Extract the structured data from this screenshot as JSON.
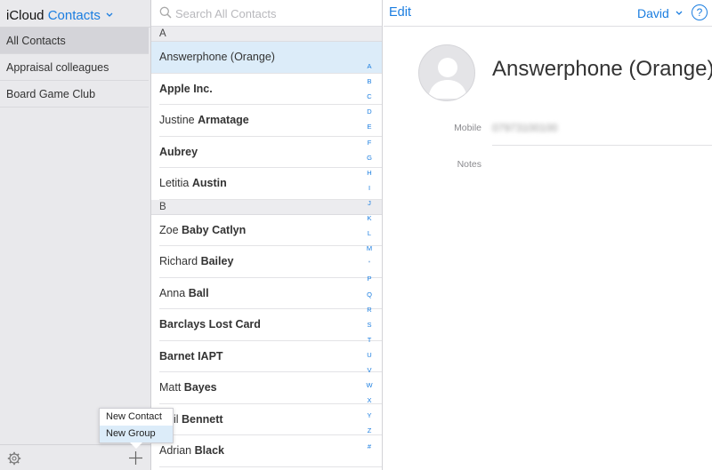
{
  "sidebar": {
    "brand": "iCloud",
    "app_name": "Contacts",
    "groups": [
      {
        "label": "All Contacts",
        "active": true
      },
      {
        "label": "Appraisal colleagues",
        "active": false
      },
      {
        "label": "Board Game Club",
        "active": false
      }
    ],
    "icons": {
      "settings": "gear-icon",
      "add": "plus-icon"
    }
  },
  "popover": {
    "items": [
      {
        "label": "New Contact",
        "active": false
      },
      {
        "label": "New Group",
        "active": true
      }
    ]
  },
  "search": {
    "placeholder": "Search All Contacts"
  },
  "contact_list": {
    "sections": [
      {
        "letter": "A",
        "contacts": [
          {
            "first": "",
            "last": "Answerphone (Orange)",
            "selected": true
          },
          {
            "first": "",
            "last": "Apple Inc.",
            "selected": false
          },
          {
            "first": "Justine",
            "last": "Armatage",
            "selected": false
          },
          {
            "first": "",
            "last": "Aubrey",
            "selected": false
          },
          {
            "first": "Letitia",
            "last": "Austin",
            "selected": false
          }
        ]
      },
      {
        "letter": "B",
        "contacts": [
          {
            "first": "Zoe",
            "last": "Baby Catlyn",
            "selected": false
          },
          {
            "first": "Richard",
            "last": "Bailey",
            "selected": false
          },
          {
            "first": "Anna",
            "last": "Ball",
            "selected": false
          },
          {
            "first": "",
            "last": "Barclays Lost Card",
            "selected": false
          },
          {
            "first": "",
            "last": "Barnet IAPT",
            "selected": false
          },
          {
            "first": "Matt",
            "last": "Bayes",
            "selected": false
          },
          {
            "first": "Neil",
            "last": "Bennett",
            "selected": false
          },
          {
            "first": "Adrian",
            "last": "Black",
            "selected": false
          }
        ]
      }
    ],
    "index": [
      "A",
      "B",
      "C",
      "D",
      "E",
      "F",
      "G",
      "H",
      "I",
      "J",
      "K",
      "L",
      "M",
      "•",
      "P",
      "Q",
      "R",
      "S",
      "T",
      "U",
      "V",
      "W",
      "X",
      "Y",
      "Z",
      "#"
    ]
  },
  "detail": {
    "edit_label": "Edit",
    "user_label": "David",
    "help_label": "?",
    "name": "Answerphone (Orange)",
    "fields": [
      {
        "label": "Mobile",
        "value": "07973100100"
      },
      {
        "label": "Notes",
        "value": ""
      }
    ]
  },
  "colors": {
    "accent": "#1a7de0",
    "selected_row": "#dcecf9",
    "sidebar_bg": "#e9e9ec"
  }
}
